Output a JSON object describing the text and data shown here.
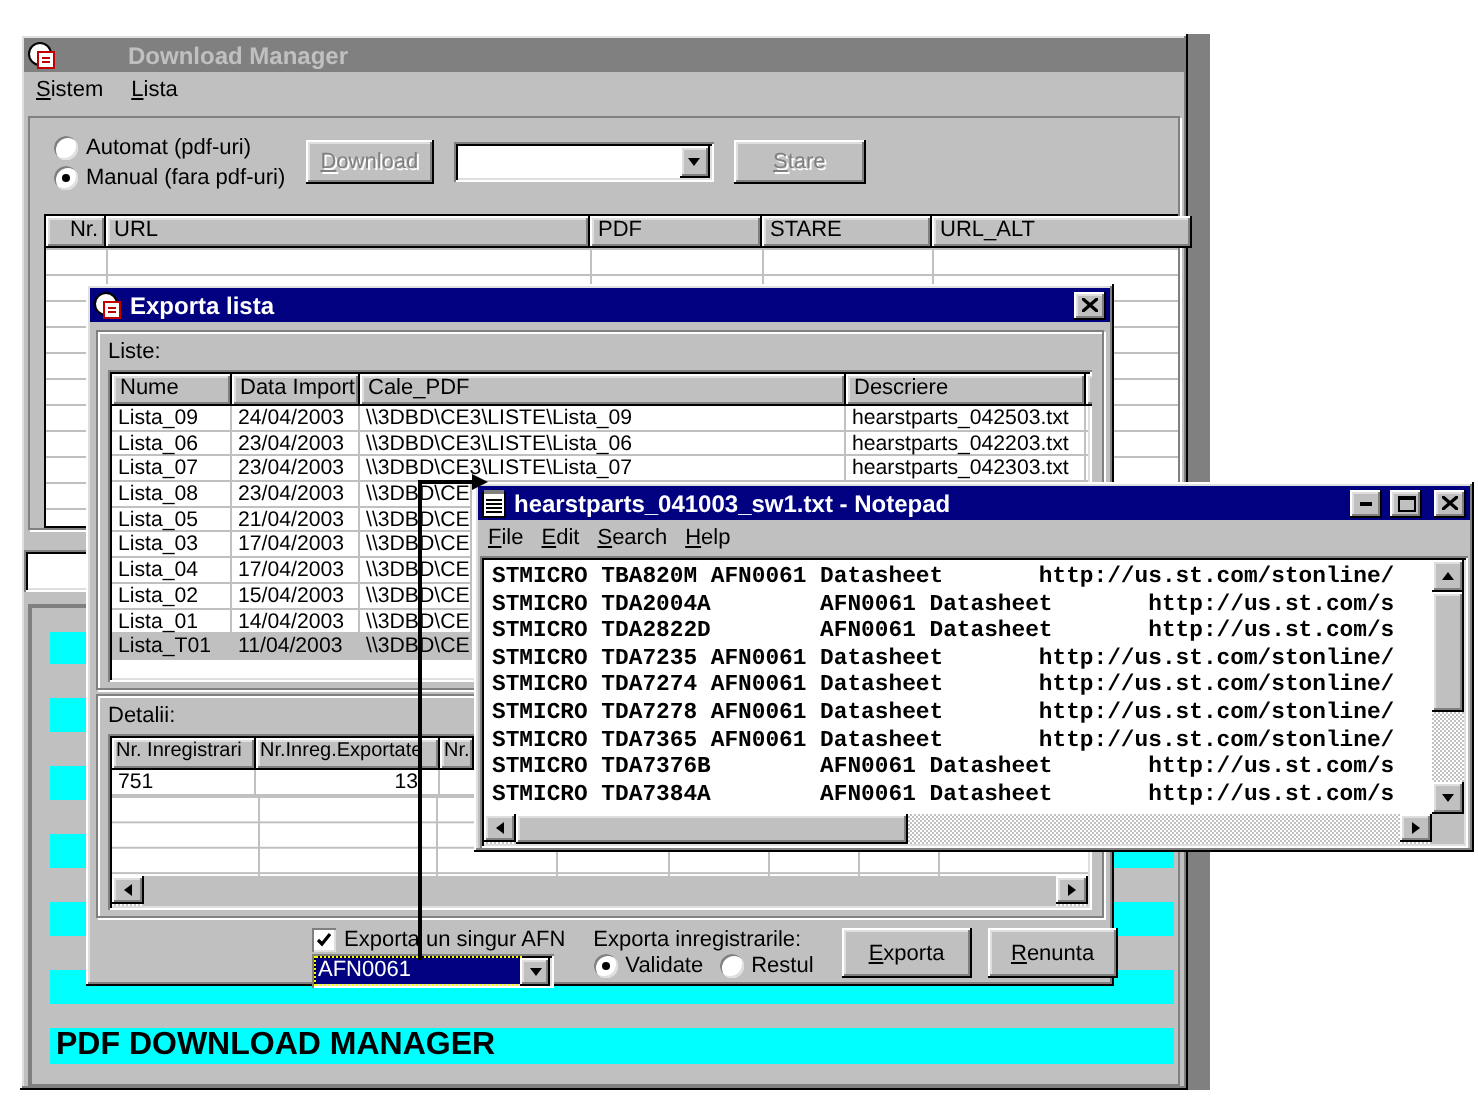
{
  "main_window": {
    "title": "Download Manager",
    "active": false,
    "menu": [
      "Sistem",
      "Lista"
    ],
    "mode_options": [
      {
        "label": "Automat (pdf-uri)",
        "selected": false
      },
      {
        "label": "Manual (fara pdf-uri)",
        "selected": true
      }
    ],
    "buttons": [
      {
        "label": "Download",
        "disabled": true
      },
      {
        "label": "Stare",
        "disabled": true
      }
    ],
    "table": {
      "columns": [
        "Nr.",
        "URL",
        "PDF",
        "STARE",
        "URL_ALT"
      ]
    },
    "banner": "PDF DOWNLOAD MANAGER"
  },
  "export_dialog": {
    "title": "Exporta lista",
    "active": true,
    "lists_label": "Liste:",
    "lists_table": {
      "columns": [
        "Nume",
        "Data Import",
        "Cale_PDF",
        "Descriere"
      ],
      "rows": [
        {
          "cells": [
            "Lista_09",
            "24/04/2003",
            "\\\\3DBD\\CE3\\LISTE\\Lista_09",
            "hearstparts_042503.txt"
          ],
          "selected": false
        },
        {
          "cells": [
            "Lista_06",
            "23/04/2003",
            "\\\\3DBD\\CE3\\LISTE\\Lista_06",
            "hearstparts_042203.txt"
          ],
          "selected": false
        },
        {
          "cells": [
            "Lista_07",
            "23/04/2003",
            "\\\\3DBD\\CE3\\LISTE\\Lista_07",
            "hearstparts_042303.txt"
          ],
          "selected": false
        },
        {
          "cells": [
            "Lista_08",
            "23/04/2003",
            "\\\\3DBD\\CE"
          ],
          "selected": false
        },
        {
          "cells": [
            "Lista_05",
            "21/04/2003",
            "\\\\3DBD\\CE"
          ],
          "selected": false
        },
        {
          "cells": [
            "Lista_03",
            "17/04/2003",
            "\\\\3DBD\\CE"
          ],
          "selected": false
        },
        {
          "cells": [
            "Lista_04",
            "17/04/2003",
            "\\\\3DBD\\CE"
          ],
          "selected": false
        },
        {
          "cells": [
            "Lista_02",
            "15/04/2003",
            "\\\\3DBD\\CE"
          ],
          "selected": false
        },
        {
          "cells": [
            "Lista_01",
            "14/04/2003",
            "\\\\3DBD\\CE"
          ],
          "selected": false
        },
        {
          "cells": [
            "Lista_T01",
            "11/04/2003",
            "\\\\3DBD\\CE"
          ],
          "selected": true
        }
      ]
    },
    "details_label": "Detalii:",
    "details_table": {
      "columns": [
        "Nr. Inregistrari",
        "Nr.Inreg.Exportate",
        "Nr."
      ],
      "rows": [
        [
          "751",
          "13"
        ]
      ]
    },
    "single_afn": {
      "label": "Exporta un singur AFN",
      "checked": true
    },
    "afn_combo": {
      "value": "AFN0061"
    },
    "export_records": {
      "label": "Exporta inregistrarile:",
      "options": [
        {
          "label": "Validate",
          "selected": true
        },
        {
          "label": "Restul",
          "selected": false
        }
      ]
    },
    "buttons": [
      "Exporta",
      "Renunta"
    ]
  },
  "notepad": {
    "title": "hearstparts_041003_sw1.txt - Notepad",
    "active": true,
    "menu": [
      "File",
      "Edit",
      "Search",
      "Help"
    ],
    "lines": [
      "STMICRO TBA820M AFN0061 Datasheet       http://us.st.com/stonline/",
      "STMICRO TDA2004A        AFN0061 Datasheet       http://us.st.com/s",
      "STMICRO TDA2822D        AFN0061 Datasheet       http://us.st.com/s",
      "STMICRO TDA7235 AFN0061 Datasheet       http://us.st.com/stonline/",
      "STMICRO TDA7274 AFN0061 Datasheet       http://us.st.com/stonline/",
      "STMICRO TDA7278 AFN0061 Datasheet       http://us.st.com/stonline/",
      "STMICRO TDA7365 AFN0061 Datasheet       http://us.st.com/stonline/",
      "STMICRO TDA7376B        AFN0061 Datasheet       http://us.st.com/s",
      "STMICRO TDA7384A        AFN0061 Datasheet       http://us.st.com/s"
    ]
  }
}
